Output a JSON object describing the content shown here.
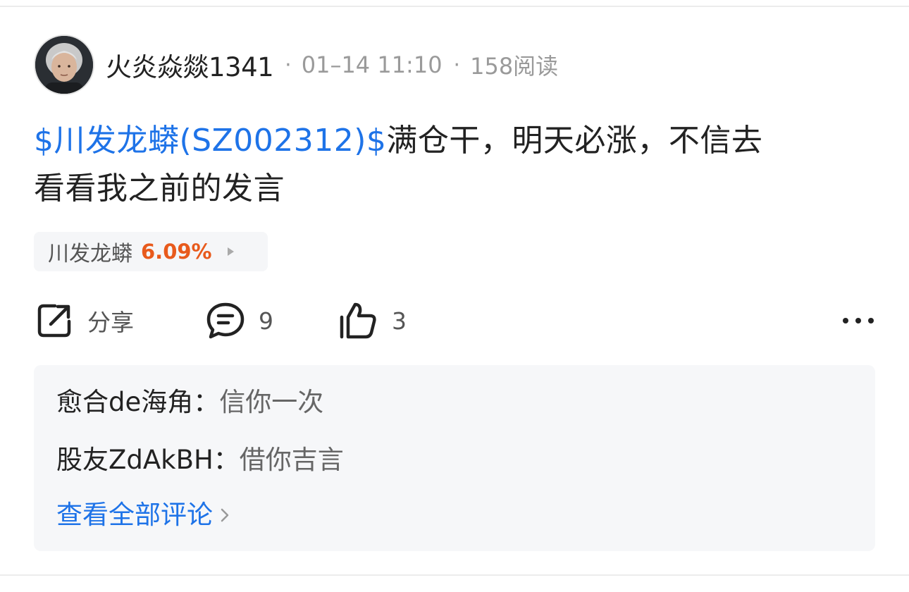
{
  "post": {
    "author": "火炎焱燚1341",
    "timestamp": "01–14 11:10",
    "views": "158阅读",
    "stock_tag": "$川发龙蟒(SZ002312)$",
    "content_line1": "满仓干，明天必涨，不信去",
    "content_line2": "看看我之前的发言"
  },
  "stock_chip": {
    "name": "川发龙蟒",
    "change": "6.09%",
    "change_color": "#e85a1c"
  },
  "actions": {
    "share_label": "分享",
    "comment_count": "9",
    "like_count": "3",
    "icons": [
      "share-icon",
      "comment-icon",
      "thumbs-up-icon",
      "more-icon"
    ]
  },
  "comments": {
    "items": [
      {
        "user": "愈合de海角",
        "separator": "：",
        "text": "信你一次"
      },
      {
        "user": "股友ZdAkBH",
        "separator": "：",
        "text": "借你吉言"
      }
    ],
    "view_all_label": "查看全部评论"
  },
  "colors": {
    "link": "#1e73e8",
    "muted": "#9a9a9a",
    "panel_bg": "#f6f7f9"
  }
}
